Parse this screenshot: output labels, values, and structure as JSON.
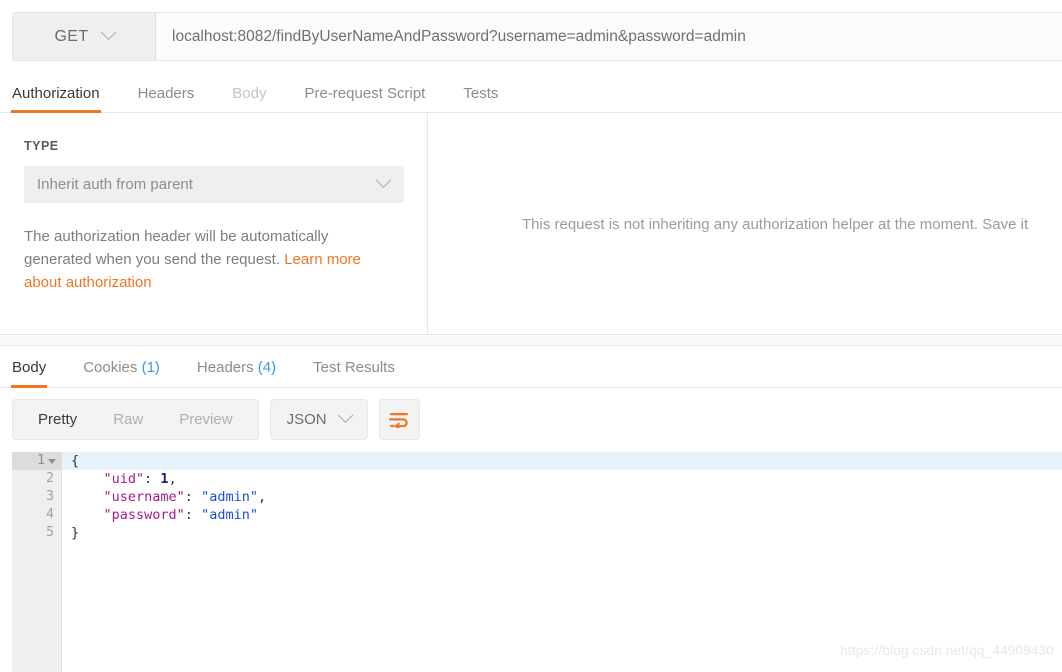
{
  "request": {
    "method": "GET",
    "url": "localhost:8082/findByUserNameAndPassword?username=admin&password=admin",
    "tabs": [
      {
        "label": "Authorization",
        "state": "active"
      },
      {
        "label": "Headers",
        "state": "normal"
      },
      {
        "label": "Body",
        "state": "dim"
      },
      {
        "label": "Pre-request Script",
        "state": "normal"
      },
      {
        "label": "Tests",
        "state": "normal"
      }
    ]
  },
  "authorization": {
    "type_label": "TYPE",
    "selected_type": "Inherit auth from parent",
    "help_text_part1": "The authorization header will be automatically generated when you send the request. ",
    "help_link": "Learn more about authorization",
    "right_message": "This request is not inheriting any authorization helper at the moment. Save it"
  },
  "response": {
    "tabs": [
      {
        "label": "Body",
        "count": "",
        "state": "active"
      },
      {
        "label": "Cookies",
        "count": "(1)",
        "state": "normal"
      },
      {
        "label": "Headers",
        "count": "(4)",
        "state": "normal"
      },
      {
        "label": "Test Results",
        "count": "",
        "state": "normal"
      }
    ],
    "view_modes": [
      {
        "label": "Pretty",
        "state": "active"
      },
      {
        "label": "Raw",
        "state": "normal"
      },
      {
        "label": "Preview",
        "state": "normal"
      }
    ],
    "format": "JSON",
    "wrap_icon": "word-wrap-icon",
    "body_lines": [
      {
        "num": "1",
        "tokens": [
          {
            "t": "{",
            "c": "p"
          }
        ]
      },
      {
        "num": "2",
        "tokens": [
          {
            "t": "    ",
            "c": "p"
          },
          {
            "t": "\"uid\"",
            "c": "k"
          },
          {
            "t": ": ",
            "c": "p"
          },
          {
            "t": "1",
            "c": "n"
          },
          {
            "t": ",",
            "c": "p"
          }
        ]
      },
      {
        "num": "3",
        "tokens": [
          {
            "t": "    ",
            "c": "p"
          },
          {
            "t": "\"username\"",
            "c": "k"
          },
          {
            "t": ": ",
            "c": "p"
          },
          {
            "t": "\"admin\"",
            "c": "s"
          },
          {
            "t": ",",
            "c": "p"
          }
        ]
      },
      {
        "num": "4",
        "tokens": [
          {
            "t": "    ",
            "c": "p"
          },
          {
            "t": "\"password\"",
            "c": "k"
          },
          {
            "t": ": ",
            "c": "p"
          },
          {
            "t": "\"admin\"",
            "c": "s"
          }
        ]
      },
      {
        "num": "5",
        "tokens": [
          {
            "t": "}",
            "c": "p"
          }
        ]
      }
    ]
  },
  "watermark": "https://blog.csdn.net/qq_44909430",
  "colors": {
    "accent": "#ef7724",
    "count_blue": "#3a9ae0",
    "highlight_row": "#e8f2fb",
    "json_key": "#a11d8e",
    "json_string": "#1a4fd6",
    "json_number": "#19188f"
  }
}
